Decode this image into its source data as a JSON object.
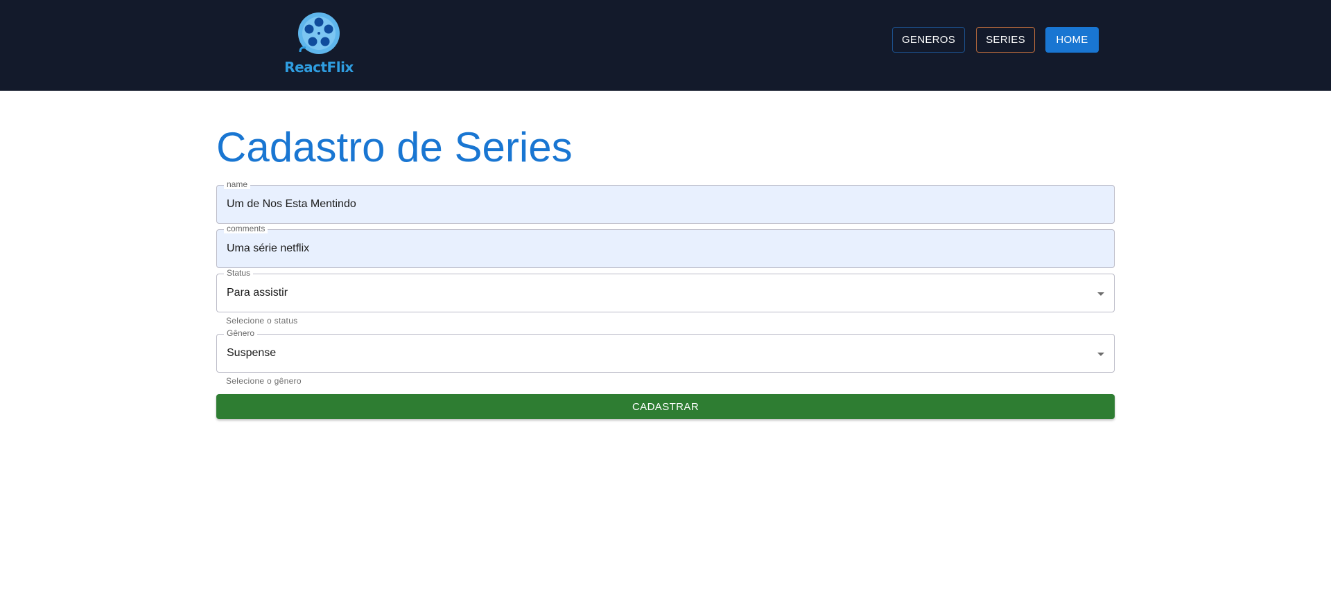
{
  "header": {
    "logo_text": "ReactFlix",
    "nav": [
      {
        "label": "GENEROS"
      },
      {
        "label": "SERIES"
      },
      {
        "label": "HOME"
      }
    ]
  },
  "main": {
    "title": "Cadastro de Series",
    "form": {
      "name": {
        "label": "name",
        "value": "Um de Nos Esta Mentindo"
      },
      "comments": {
        "label": "comments",
        "value": "Uma série netflix"
      },
      "status": {
        "label": "Status",
        "value": "Para assistir",
        "helper": "Selecione o status"
      },
      "genero": {
        "label": "Gênero",
        "value": "Suspense",
        "helper": "Selecione o gênero"
      },
      "submit_label": "CADASTRAR"
    }
  },
  "colors": {
    "header_bg": "#131a2b",
    "accent": "#1976d2",
    "submit_bg": "#2e7d32",
    "autofill_bg": "#e8f0fe"
  },
  "icons": {
    "logo": "film-reel-icon",
    "select_caret": "caret-down-icon"
  }
}
